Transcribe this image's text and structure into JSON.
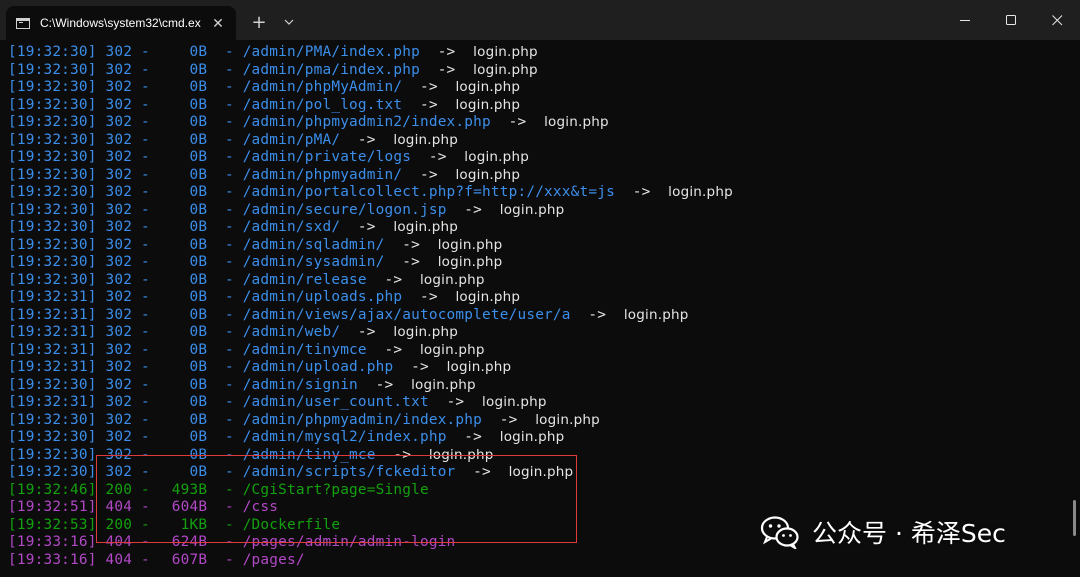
{
  "window": {
    "tab_title": "C:\\Windows\\system32\\cmd.ex",
    "tab_close_glyph": "✕",
    "new_tab_glyph": "+",
    "dropdown_glyph": "⌄",
    "minimize_glyph": "—",
    "close_glyph": "✕"
  },
  "colors": {
    "status_302": "#3b8eea",
    "status_200": "#13a10e",
    "status_404": "#b148c6",
    "text": "#e6e6e6",
    "highlight": "#e03a3a"
  },
  "log": [
    {
      "ts": "[19:32:30]",
      "code": "302",
      "size": "0B",
      "path": "/admin/PMA/index.php",
      "target": "login.php"
    },
    {
      "ts": "[19:32:30]",
      "code": "302",
      "size": "0B",
      "path": "/admin/pma/index.php",
      "target": "login.php"
    },
    {
      "ts": "[19:32:30]",
      "code": "302",
      "size": "0B",
      "path": "/admin/phpMyAdmin/",
      "target": "login.php"
    },
    {
      "ts": "[19:32:30]",
      "code": "302",
      "size": "0B",
      "path": "/admin/pol_log.txt",
      "target": "login.php"
    },
    {
      "ts": "[19:32:30]",
      "code": "302",
      "size": "0B",
      "path": "/admin/phpmyadmin2/index.php",
      "target": "login.php"
    },
    {
      "ts": "[19:32:30]",
      "code": "302",
      "size": "0B",
      "path": "/admin/pMA/",
      "target": "login.php"
    },
    {
      "ts": "[19:32:30]",
      "code": "302",
      "size": "0B",
      "path": "/admin/private/logs",
      "target": "login.php"
    },
    {
      "ts": "[19:32:30]",
      "code": "302",
      "size": "0B",
      "path": "/admin/phpmyadmin/",
      "target": "login.php"
    },
    {
      "ts": "[19:32:30]",
      "code": "302",
      "size": "0B",
      "path": "/admin/portalcollect.php?f=http://xxx&t=js",
      "target": "login.php"
    },
    {
      "ts": "[19:32:30]",
      "code": "302",
      "size": "0B",
      "path": "/admin/secure/logon.jsp",
      "target": "login.php"
    },
    {
      "ts": "[19:32:30]",
      "code": "302",
      "size": "0B",
      "path": "/admin/sxd/",
      "target": "login.php"
    },
    {
      "ts": "[19:32:30]",
      "code": "302",
      "size": "0B",
      "path": "/admin/sqladmin/",
      "target": "login.php"
    },
    {
      "ts": "[19:32:30]",
      "code": "302",
      "size": "0B",
      "path": "/admin/sysadmin/",
      "target": "login.php"
    },
    {
      "ts": "[19:32:30]",
      "code": "302",
      "size": "0B",
      "path": "/admin/release",
      "target": "login.php"
    },
    {
      "ts": "[19:32:31]",
      "code": "302",
      "size": "0B",
      "path": "/admin/uploads.php",
      "target": "login.php"
    },
    {
      "ts": "[19:32:31]",
      "code": "302",
      "size": "0B",
      "path": "/admin/views/ajax/autocomplete/user/a",
      "target": "login.php"
    },
    {
      "ts": "[19:32:31]",
      "code": "302",
      "size": "0B",
      "path": "/admin/web/",
      "target": "login.php"
    },
    {
      "ts": "[19:32:31]",
      "code": "302",
      "size": "0B",
      "path": "/admin/tinymce",
      "target": "login.php"
    },
    {
      "ts": "[19:32:31]",
      "code": "302",
      "size": "0B",
      "path": "/admin/upload.php",
      "target": "login.php"
    },
    {
      "ts": "[19:32:30]",
      "code": "302",
      "size": "0B",
      "path": "/admin/signin",
      "target": "login.php"
    },
    {
      "ts": "[19:32:31]",
      "code": "302",
      "size": "0B",
      "path": "/admin/user_count.txt",
      "target": "login.php"
    },
    {
      "ts": "[19:32:30]",
      "code": "302",
      "size": "0B",
      "path": "/admin/phpmyadmin/index.php",
      "target": "login.php"
    },
    {
      "ts": "[19:32:30]",
      "code": "302",
      "size": "0B",
      "path": "/admin/mysql2/index.php",
      "target": "login.php"
    },
    {
      "ts": "[19:32:30]",
      "code": "302",
      "size": "0B",
      "path": "/admin/tiny_mce",
      "target": "login.php"
    },
    {
      "ts": "[19:32:30]",
      "code": "302",
      "size": "0B",
      "path": "/admin/scripts/fckeditor",
      "target": "login.php"
    },
    {
      "ts": "[19:32:46]",
      "code": "200",
      "size": "493B",
      "path": "/CgiStart?page=Single",
      "target": ""
    },
    {
      "ts": "[19:32:51]",
      "code": "404",
      "size": "604B",
      "path": "/css",
      "target": ""
    },
    {
      "ts": "[19:32:53]",
      "code": "200",
      "size": "1KB",
      "path": "/Dockerfile",
      "target": ""
    },
    {
      "ts": "[19:33:16]",
      "code": "404",
      "size": "624B",
      "path": "/pages/admin/admin-login",
      "target": ""
    },
    {
      "ts": "[19:33:16]",
      "code": "404",
      "size": "607B",
      "path": "/pages/",
      "target": ""
    }
  ],
  "watermark": {
    "text": "公众号 · 希泽Sec"
  }
}
